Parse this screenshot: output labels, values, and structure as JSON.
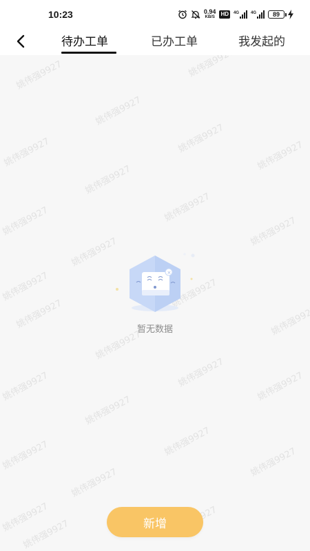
{
  "status_bar": {
    "time": "10:23",
    "net_speed_value": "0.94",
    "net_speed_unit": "KB/S",
    "hd_label": "HD",
    "battery": "89",
    "icons": [
      "alarm-icon",
      "mute-icon",
      "hd-icon",
      "signal-4g-icon",
      "signal-4g-icon",
      "battery-icon",
      "charging-icon"
    ]
  },
  "tabs": [
    {
      "label": "待办工单",
      "active": true
    },
    {
      "label": "已办工单",
      "active": false
    },
    {
      "label": "我发起的",
      "active": false
    }
  ],
  "empty_state": {
    "text": "暂无数据"
  },
  "add_button": {
    "label": "新增"
  },
  "watermark": {
    "text": "姚伟强9927"
  },
  "colors": {
    "accent": "#f9c565",
    "background": "#f7f7f7",
    "empty_text": "#8c8c8c"
  }
}
